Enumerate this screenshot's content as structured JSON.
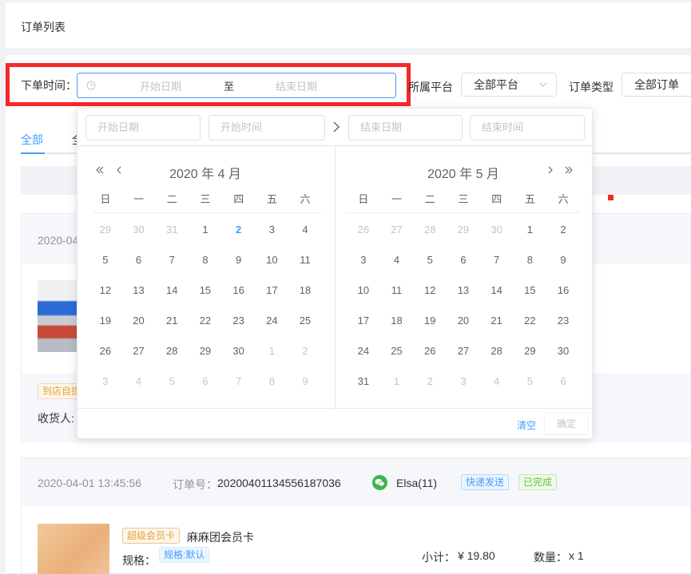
{
  "header": {
    "title": "订单列表"
  },
  "filters": {
    "order_time_label": "下单时间：",
    "start_placeholder": "开始日期",
    "range_separator": "至",
    "end_placeholder": "结束日期",
    "platform_label": "所属平台",
    "platform_value": "全部平台",
    "order_type_label": "订单类型",
    "order_type_value": "全部订单"
  },
  "tabs": {
    "active": "全部",
    "second_partial": "全"
  },
  "datepicker": {
    "start_date_placeholder": "开始日期",
    "start_time_placeholder": "开始时间",
    "end_date_placeholder": "结束日期",
    "end_time_placeholder": "结束时间",
    "weekdays": [
      "日",
      "一",
      "二",
      "三",
      "四",
      "五",
      "六"
    ],
    "left_title": "2020 年 4 月",
    "right_title": "2020 年 5 月",
    "today": 2,
    "left_days": [
      [
        "29",
        "30",
        "31",
        "1",
        "2",
        "3",
        "4"
      ],
      [
        "5",
        "6",
        "7",
        "8",
        "9",
        "10",
        "11"
      ],
      [
        "12",
        "13",
        "14",
        "15",
        "16",
        "17",
        "18"
      ],
      [
        "19",
        "20",
        "21",
        "22",
        "23",
        "24",
        "25"
      ],
      [
        "26",
        "27",
        "28",
        "29",
        "30",
        "1",
        "2"
      ],
      [
        "3",
        "4",
        "5",
        "6",
        "7",
        "8",
        "9"
      ]
    ],
    "right_days": [
      [
        "26",
        "27",
        "28",
        "29",
        "30",
        "1",
        "2"
      ],
      [
        "3",
        "4",
        "5",
        "6",
        "7",
        "8",
        "9"
      ],
      [
        "10",
        "11",
        "12",
        "13",
        "14",
        "15",
        "16"
      ],
      [
        "17",
        "18",
        "19",
        "20",
        "21",
        "22",
        "23"
      ],
      [
        "24",
        "25",
        "26",
        "27",
        "28",
        "29",
        "30"
      ],
      [
        "31",
        "1",
        "2",
        "3",
        "4",
        "5",
        "6"
      ]
    ],
    "clear_label": "清空",
    "confirm_label": "确定"
  },
  "order1": {
    "date_partial": "2020-04",
    "pickup_tag_partial": "到店自提",
    "receiver_label": "收货人:"
  },
  "order2": {
    "datetime": "2020-04-01 13:45:56",
    "order_no_label": "订单号：",
    "order_no": "20200401134556187036",
    "customer": "Elsa(11)",
    "delivery_tag": "快递发送",
    "status_tag": "已完成",
    "product_tag": "超级会员卡",
    "product_name": "麻麻团会员卡",
    "spec_label": "规格：",
    "spec_value": "规格:默认",
    "subtotal_label": "小计：",
    "subtotal": "¥ 19.80",
    "qty_label": "数量：",
    "qty": "x 1"
  },
  "colors": {
    "accent": "#409eff",
    "highlight_border": "#f5292a",
    "wechat": "#3bb64c",
    "warning": "#e6a23c",
    "success": "#67c23a"
  }
}
